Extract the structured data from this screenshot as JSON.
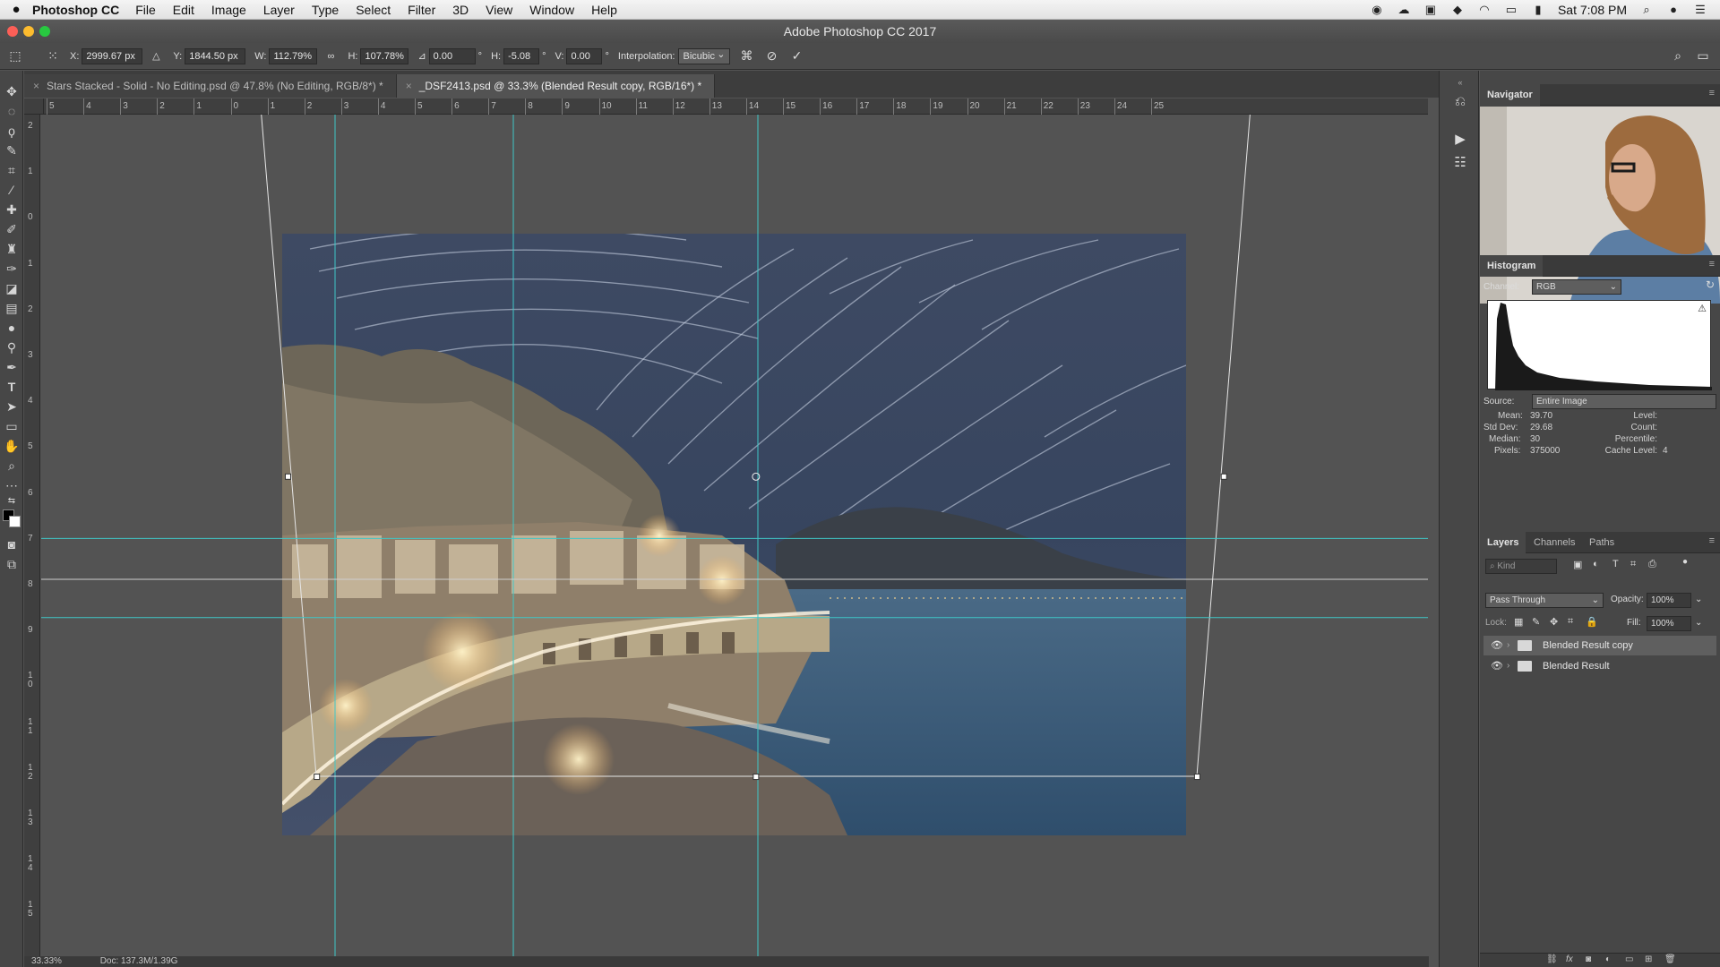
{
  "menubar": {
    "apple": "",
    "app_name": "Photoshop CC",
    "items": [
      "File",
      "Edit",
      "Image",
      "Layer",
      "Type",
      "Select",
      "Filter",
      "3D",
      "View",
      "Window",
      "Help"
    ],
    "clock": "Sat 7:08 PM"
  },
  "window": {
    "title": "Adobe Photoshop CC 2017"
  },
  "options": {
    "x_label": "X:",
    "x_value": "2999.67 px",
    "y_label": "Y:",
    "y_value": "1844.50 px",
    "w_label": "W:",
    "w_value": "112.79%",
    "h_label": "H:",
    "h_value": "107.78%",
    "angle_value": "0.00",
    "hskew_label": "H:",
    "hskew_value": "-5.08",
    "vskew_label": "V:",
    "vskew_value": "0.00",
    "interp_label": "Interpolation:",
    "interp_value": "Bicubic"
  },
  "tabs": [
    {
      "label": "Stars Stacked - Solid - No Editing.psd @ 47.8% (No Editing, RGB/8*) *"
    },
    {
      "label": "_DSF2413.psd @ 33.3% (Blended Result copy, RGB/16*) *"
    }
  ],
  "ruler": {
    "top_labels": [
      "5",
      "4",
      "3",
      "2",
      "1",
      "0",
      "1",
      "2",
      "3",
      "4",
      "5",
      "6",
      "7",
      "8",
      "9",
      "10",
      "11",
      "12",
      "13",
      "14",
      "15",
      "16",
      "17",
      "18",
      "19",
      "20",
      "21",
      "22",
      "23",
      "24",
      "25"
    ],
    "left_labels": [
      "2",
      "1",
      "0",
      "1",
      "2",
      "3",
      "4",
      "5",
      "6",
      "7",
      "8",
      "9",
      "10",
      "11",
      "12",
      "13",
      "14",
      "15"
    ]
  },
  "status": {
    "zoom": "33.33%",
    "doc": "Doc: 137.3M/1.39G"
  },
  "navigator": {
    "title": "Navigator"
  },
  "histogram": {
    "title": "Histogram",
    "channel_label": "Channel:",
    "channel_value": "RGB",
    "source_label": "Source:",
    "source_value": "Entire Image",
    "mean_label": "Mean:",
    "mean_value": "39.70",
    "stddev_label": "Std Dev:",
    "stddev_value": "29.68",
    "median_label": "Median:",
    "median_value": "30",
    "pixels_label": "Pixels:",
    "pixels_value": "375000",
    "level_label": "Level:",
    "count_label": "Count:",
    "percentile_label": "Percentile:",
    "cache_label": "Cache Level:",
    "cache_value": "4"
  },
  "layers_panel": {
    "tabs": [
      "Layers",
      "Channels",
      "Paths"
    ],
    "filter_placeholder": "Kind",
    "blend_mode": "Pass Through",
    "opacity_label": "Opacity:",
    "opacity_value": "100%",
    "lock_label": "Lock:",
    "fill_label": "Fill:",
    "fill_value": "100%",
    "layers": [
      {
        "name": "Blended Result copy",
        "selected": true
      },
      {
        "name": "Blended Result",
        "selected": false
      }
    ]
  },
  "colors": {
    "guide": "#3fc7c7",
    "panel": "#474747",
    "canvas": "#535353"
  }
}
